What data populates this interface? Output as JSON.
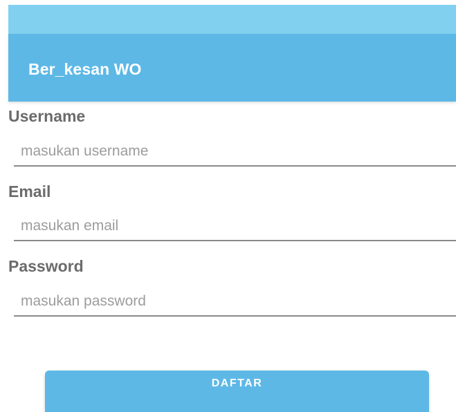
{
  "app": {
    "title": "Ber_kesan WO"
  },
  "form": {
    "username": {
      "label": "Username",
      "placeholder": "masukan username",
      "value": ""
    },
    "email": {
      "label": "Email",
      "placeholder": "masukan email",
      "value": ""
    },
    "password": {
      "label": "Password",
      "placeholder": "masukan password",
      "value": ""
    },
    "submit_label": "DAFTAR"
  },
  "colors": {
    "status_bar": "#81d0f0",
    "app_bar": "#5db8e6",
    "button": "#5db8e6",
    "label_text": "#6b6b6b",
    "placeholder_text": "#9c9c9c",
    "underline": "#8a8a8a"
  }
}
